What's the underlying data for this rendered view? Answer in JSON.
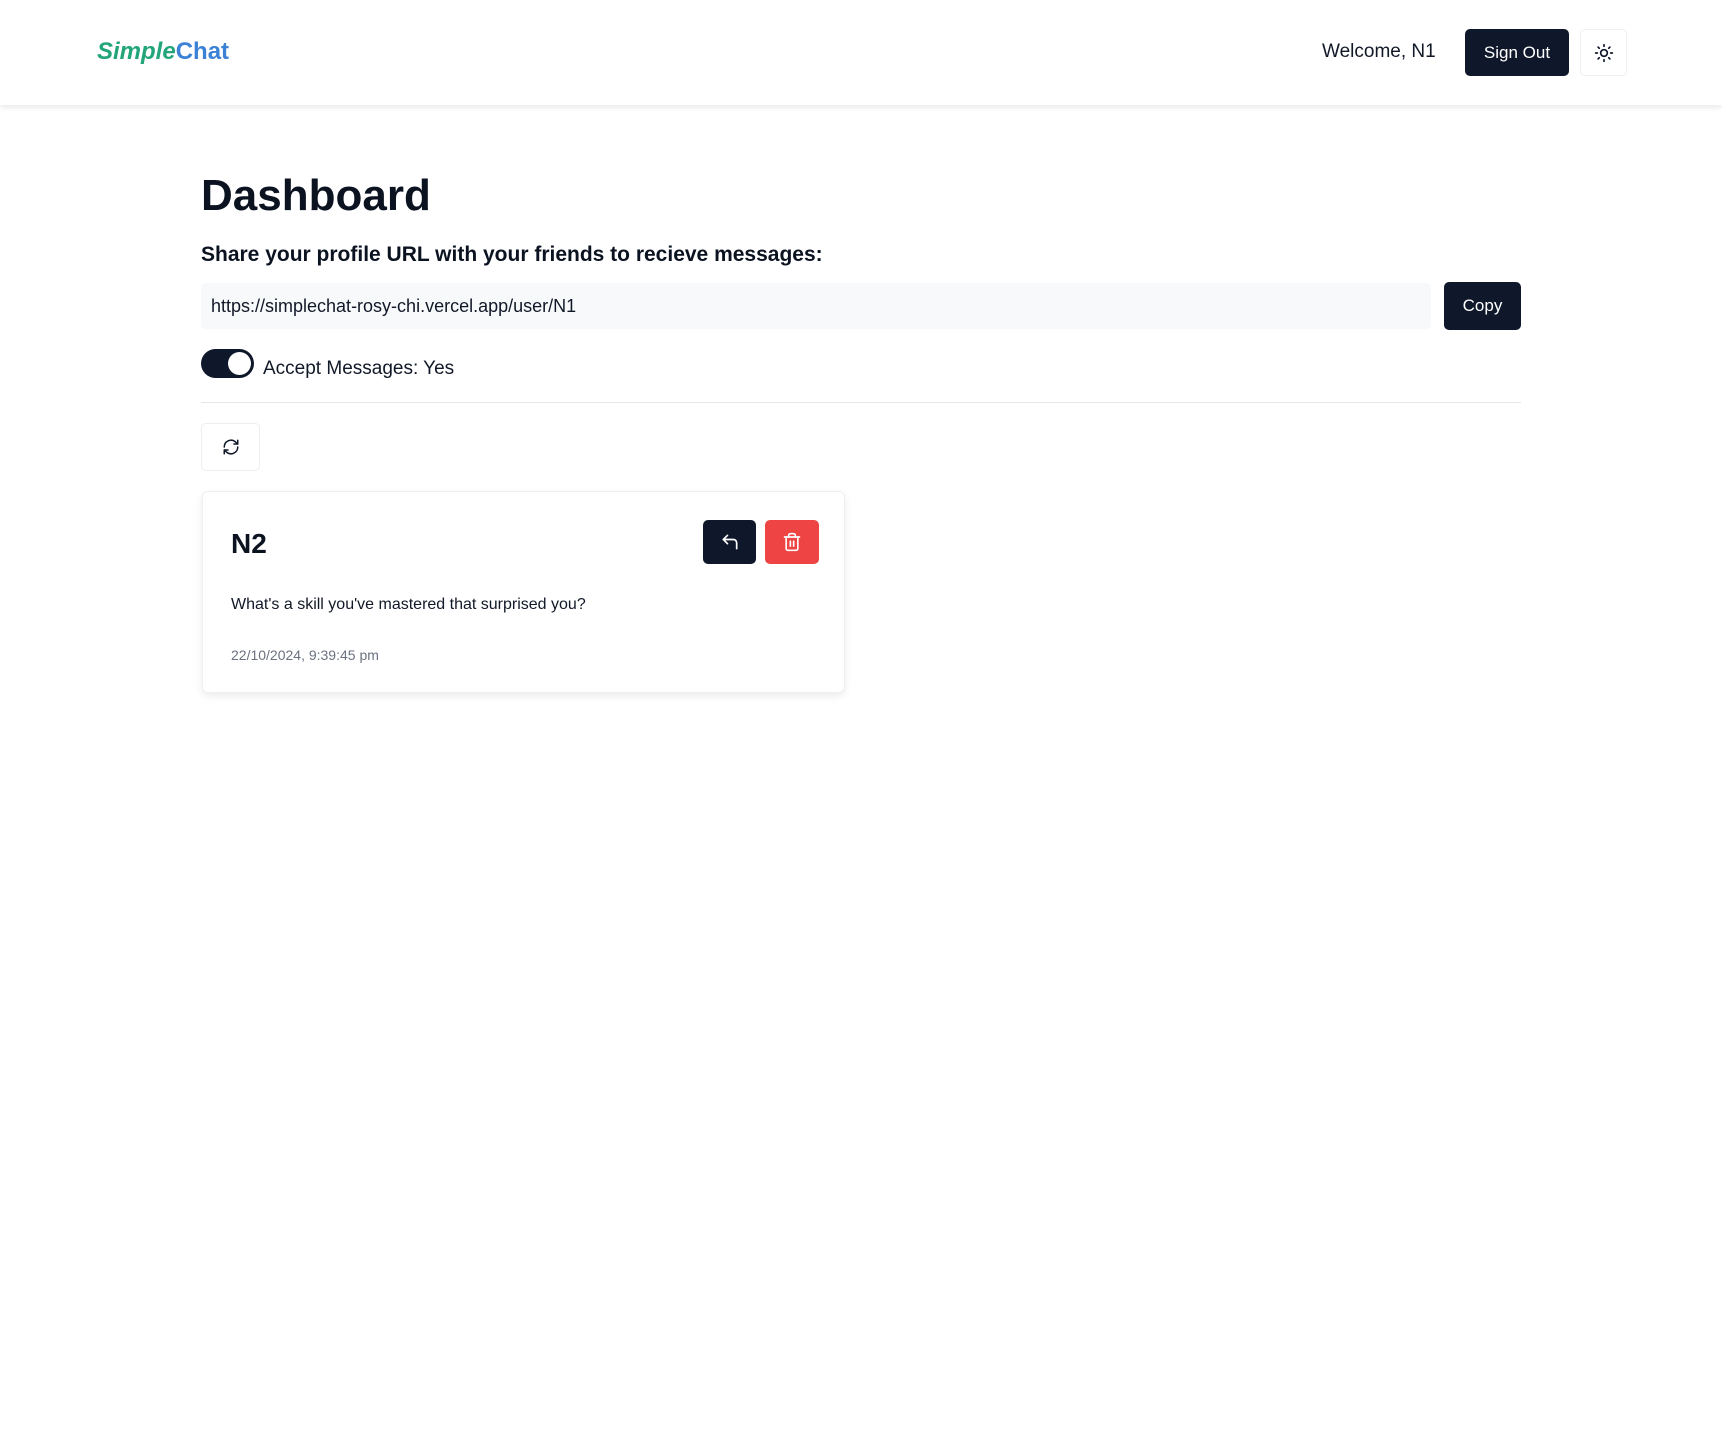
{
  "header": {
    "logo_part1": "Simple",
    "logo_part2": "Chat",
    "welcome_text": "Welcome, N1",
    "signout_label": "Sign Out",
    "theme_icon": "sun-icon"
  },
  "main": {
    "title": "Dashboard",
    "share_label": "Share your profile URL with your friends to recieve messages:",
    "profile_url": "https://simplechat-rosy-chi.vercel.app/user/N1",
    "copy_label": "Copy",
    "accept_messages_label": "Accept Messages: Yes",
    "accept_messages_on": true,
    "refresh_icon": "refresh-icon"
  },
  "messages": [
    {
      "sender": "N2",
      "content": "What's a skill you've mastered that surprised you?",
      "timestamp": "22/10/2024, 9:39:45 pm",
      "reply_icon": "reply-icon",
      "delete_icon": "trash-icon"
    }
  ],
  "colors": {
    "primary": "#0f172a",
    "danger": "#ef4444",
    "logo_green": "#22a57a",
    "logo_blue": "#3b82d6"
  }
}
